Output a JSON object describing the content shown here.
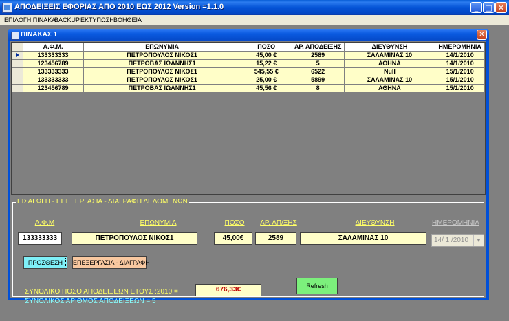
{
  "window": {
    "title": "ΑΠΟΔΕΙΞΕΙΣ ΕΦΟΡΙΑΣ ΑΠΟ 2010 ΕΩΣ 2012  Version =1.1.0",
    "minimize": "_",
    "maximize": "□",
    "close": "✕"
  },
  "menu": [
    "ΕΠΙΛΟΓΗ ΠΙΝΑΚΑ",
    "BACKUP",
    "ΕΚΤΥΠΩΣΗ",
    "ΒΟΗΘΕΙΑ"
  ],
  "child": {
    "title": "ΠΙΝΑΚΑΣ 1",
    "close": "✕"
  },
  "grid": {
    "columns": [
      "Α.Φ.Μ.",
      "ΕΠΩΝΥΜΙΑ",
      "ΠΟΣΟ",
      "ΑΡ. ΑΠΟΔΕΙΞΗΣ",
      "ΔΙΕΥΘΥΝΣΗ",
      "ΗΜΕΡΟΜΗΝΙΑ"
    ],
    "rows": [
      [
        "133333333",
        "ΠΕΤΡΟΠΟΥΛΟΣ ΝΙΚΟΣ1",
        "45,00 €",
        "2589",
        "ΣΑΛΑΜΙΝΑΣ 10",
        "14/1/2010"
      ],
      [
        "123456789",
        "ΠΕΤΡΟΒΑΣ ΙΩΑΝΝΗΣ1",
        "15,22 €",
        "5",
        "ΑΘΗΝΑ",
        "14/1/2010"
      ],
      [
        "133333333",
        "ΠΕΤΡΟΠΟΥΛΟΣ ΝΙΚΟΣ1",
        "545,55 €",
        "6522",
        "Null",
        "15/1/2010"
      ],
      [
        "133333333",
        "ΠΕΤΡΟΠΟΥΛΟΣ ΝΙΚΟΣ1",
        "25,00 €",
        "5899",
        "ΣΑΛΑΜΙΝΑΣ 10",
        "15/1/2010"
      ],
      [
        "123456789",
        "ΠΕΤΡΟΒΑΣ ΙΩΑΝΝΗΣ1",
        "45,56 €",
        "8",
        "ΑΘΗΝΑ",
        "15/1/2010"
      ]
    ],
    "selected_row": 0
  },
  "editor": {
    "group_title": "ΕΙΣΑΓΩΓΗ - ΕΠΕΞΕΡΓΑΣΙΑ - ΔΙΑΓΡΑΦΗ ΔΕΔΟΜΕΝΩΝ",
    "labels": {
      "afm": "Α.Φ.Μ",
      "name": "ΕΠΩΝΥΜΙΑ",
      "amount": "ΠΟΣΟ",
      "receipt": "ΑΡ. ΑΠ/ΞΗΣ",
      "address": "ΔΙΕΥΘΥΝΣΗ",
      "date": "ΗΜΕΡΟΜΗΝΙΑ"
    },
    "values": {
      "afm": "133333333",
      "name": "ΠΕΤΡΟΠΟΥΛΟΣ ΝΙΚΟΣ1",
      "amount": "45,00€",
      "receipt": "2589",
      "address": "ΣΑΛΑΜΙΝΑΣ 10",
      "date": "14/ 1 /2010"
    },
    "add_button": "ΠΡΟΣΘΕΣΗ",
    "edit_button": "ΕΠΕΞΕΡΓΑΣΙΑ - ΔΙΑΓΡΑΦΗ",
    "refresh_button": "Refresh",
    "total_label": "ΣΥΝΟΛΙΚΟ ΠΟΣΟ ΑΠΟΔΕΙΞΕΩΝ ΕΤΟΥΣ :2010 =",
    "total_value": "676,33€",
    "count_label": "ΣΥΝΟΛΙΚΟΣ ΑΡΙΘΜΟΣ ΑΠΟΔΕΙΞΕΩΝ = 5"
  },
  "colors": {
    "titlebar": "#0453d6",
    "grid_cell": "#fffec8",
    "label_yellow": "#ffff66",
    "label_cyan": "#88ffff",
    "total_red": "#c00000",
    "add_button": "#7ff0f8",
    "edit_button": "#f8c8a0",
    "refresh_button": "#7cf07c"
  }
}
